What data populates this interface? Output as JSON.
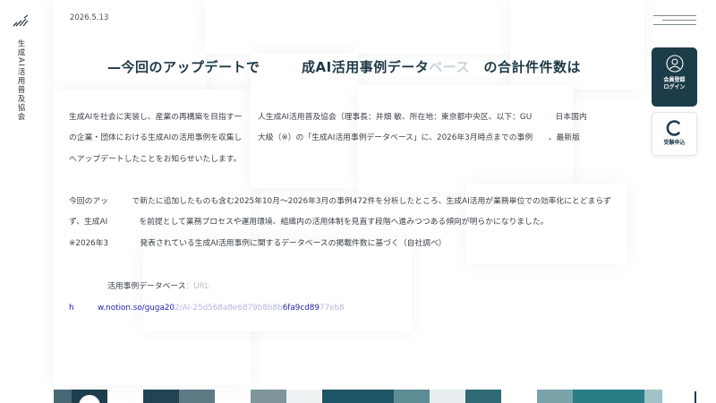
{
  "header": {
    "org_name": "生成AI活用普及協会",
    "date": "2026.5.13"
  },
  "headline": {
    "part1": "—今回のアップデートで",
    "part2": "成AI活用事例データ",
    "part3": "ベース",
    "part4": "の合計件",
    "part5": "件数は"
  },
  "body": {
    "p1a": "生成AIを社会に実装し、産業の再構築を目指す一",
    "p1b": "人生成AI活用普及協会（理事長：井畑 敏、所在地：東京都中央区、以下：GU",
    "p1c": "日本国内",
    "p2a": "の企業・団体における生成AIの活用事例を収集し",
    "p2b": "大級（※）の「生成AI活用事例データベース」に、2026年3月時点までの事例",
    "p2c": "、最新版",
    "p3": "へアップデートしたことをお知らせいたします。",
    "p4a": "今回のアッ",
    "p4b": "で新たに追加したものも含む2025年10月〜2026年3月の事例472件を分析したところ、",
    "p4c": "生成AI活用が業務単位での効率化にとどまらず",
    "p5a": "ず、生成AI",
    "p5b": "を前提として業務プロセスや運用環境、組織内の活用体制を見直す段階へ進みつつある傾向が明らかになりました。",
    "p6a": "※2026年3",
    "p6b": "発表されている生成AI活用事例に関するデータベースの掲載件数に基づく（自社調べ）",
    "db_label_a": "活用事例データベース",
    "db_label_b": "：URL",
    "url_a": "h",
    "url_b": "w.notion.so/guga20",
    "url_c": "2/AI-25d568a8e68",
    "url_d": "79b8b8b",
    "url_e": "6fa9cd89",
    "url_f": "77eb8"
  },
  "side_actions": {
    "login_label_1": "会員登録",
    "login_label_2": "ログイン",
    "apply_label": "受験申込"
  },
  "colors": {
    "brand_dark": "#1d3c4a",
    "link": "#2323b0"
  },
  "icons": {
    "logo": "diagonal-stripes-logo",
    "menu": "hamburger-menu-icon",
    "user": "user-icon",
    "apply": "crescent-logo-icon"
  }
}
